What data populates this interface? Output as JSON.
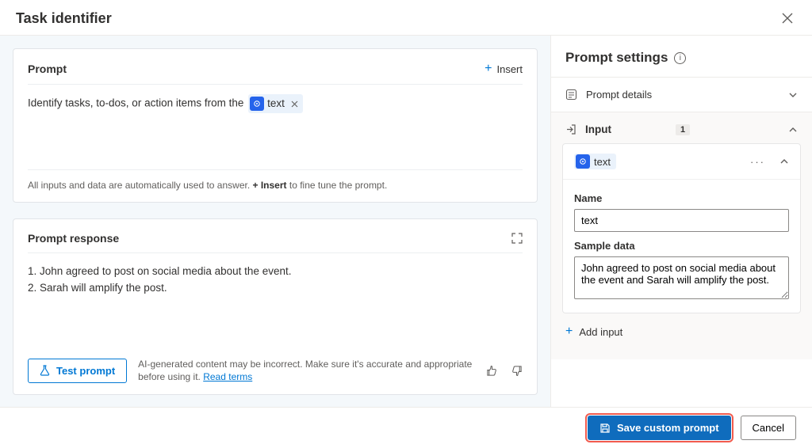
{
  "header": {
    "title": "Task identifier"
  },
  "prompt": {
    "section_title": "Prompt",
    "insert_label": "Insert",
    "text_before_chip": "Identify tasks, to-dos, or action items from the ",
    "chip_label": "text",
    "hint_prefix": "All inputs and data are automatically used to answer. ",
    "hint_bold": "+ Insert",
    "hint_suffix": " to fine tune the prompt."
  },
  "response": {
    "section_title": "Prompt response",
    "lines": [
      "1. John agreed to post on social media about the event.",
      "2. Sarah will amplify the post."
    ],
    "test_label": "Test prompt",
    "disclaimer": "AI-generated content may be incorrect. Make sure it's accurate and appropriate before using it. ",
    "read_terms": "Read terms"
  },
  "settings": {
    "title": "Prompt settings",
    "prompt_details_label": "Prompt details",
    "input_label": "Input",
    "input_count": "1",
    "input_item": {
      "chip_label": "text",
      "name_label": "Name",
      "name_value": "text",
      "sample_label": "Sample data",
      "sample_value": "John agreed to post on social media about the event and Sarah will amplify the post."
    },
    "add_input_label": "Add input"
  },
  "footer": {
    "save_label": "Save custom prompt",
    "cancel_label": "Cancel"
  }
}
